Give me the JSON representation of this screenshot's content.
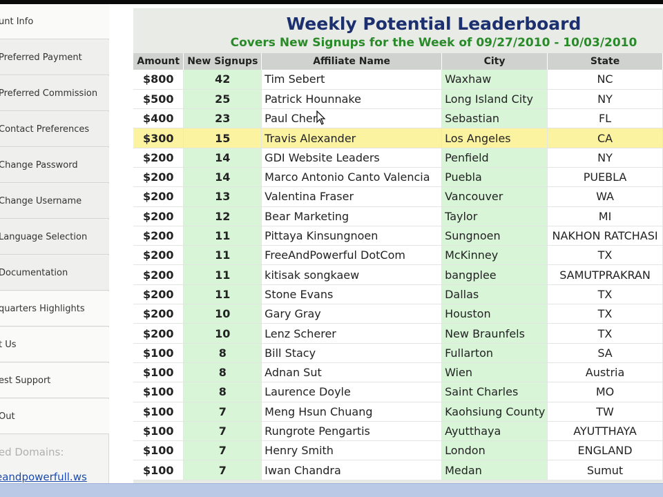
{
  "sidebar": {
    "items": [
      {
        "label": "unt Info"
      },
      {
        "label": "Preferred Payment"
      },
      {
        "label": "Preferred Commission"
      },
      {
        "label": "Contact Preferences"
      },
      {
        "label": "Change Password"
      },
      {
        "label": "Change Username"
      },
      {
        "label": "Language Selection"
      },
      {
        "label": "Documentation"
      },
      {
        "label": "quarters Highlights"
      },
      {
        "label": "t Us"
      },
      {
        "label": "est Support"
      },
      {
        "label": "Out"
      }
    ],
    "domains_label": "red Domains:",
    "domain_link": "eandpowerfull.ws"
  },
  "board": {
    "title": "Weekly Potential Leaderboard",
    "subtitle": "Covers New Signups for the Week of 09/27/2010 - 10/03/2010",
    "columns": [
      "Amount",
      "New Signups",
      "Affiliate Name",
      "City",
      "State"
    ],
    "rows": [
      {
        "amount": "$800",
        "signups": "42",
        "name": "Tim Sebert",
        "city": "Waxhaw",
        "state": "NC"
      },
      {
        "amount": "$500",
        "signups": "25",
        "name": "Patrick Hounnake",
        "city": "Long Island City",
        "state": "NY"
      },
      {
        "amount": "$400",
        "signups": "23",
        "name": "Paul Cher",
        "city": "Sebastian",
        "state": "FL"
      },
      {
        "amount": "$300",
        "signups": "15",
        "name": "Travis Alexander",
        "city": "Los Angeles",
        "state": "CA"
      },
      {
        "amount": "$200",
        "signups": "14",
        "name": "GDI Website Leaders",
        "city": "Penfield",
        "state": "NY"
      },
      {
        "amount": "$200",
        "signups": "14",
        "name": "Marco Antonio Canto Valencia",
        "city": "Puebla",
        "state": "PUEBLA"
      },
      {
        "amount": "$200",
        "signups": "13",
        "name": "Valentina Fraser",
        "city": "Vancouver",
        "state": "WA"
      },
      {
        "amount": "$200",
        "signups": "12",
        "name": "Bear Marketing",
        "city": "Taylor",
        "state": "MI"
      },
      {
        "amount": "$200",
        "signups": "11",
        "name": "Pittaya Kinsungnoen",
        "city": "Sungnoen",
        "state": "NAKHON RATCHASI"
      },
      {
        "amount": "$200",
        "signups": "11",
        "name": "FreeAndPowerful DotCom",
        "city": "McKinney",
        "state": "TX"
      },
      {
        "amount": "$200",
        "signups": "11",
        "name": "kitisak songkaew",
        "city": "bangplee",
        "state": "SAMUTPRAKRAN"
      },
      {
        "amount": "$200",
        "signups": "11",
        "name": "Stone Evans",
        "city": "Dallas",
        "state": "TX"
      },
      {
        "amount": "$200",
        "signups": "10",
        "name": "Gary Gray",
        "city": "Houston",
        "state": "TX"
      },
      {
        "amount": "$200",
        "signups": "10",
        "name": "Lenz Scherer",
        "city": "New Braunfels",
        "state": "TX"
      },
      {
        "amount": "$100",
        "signups": "8",
        "name": "Bill Stacy",
        "city": "Fullarton",
        "state": "SA"
      },
      {
        "amount": "$100",
        "signups": "8",
        "name": "Adnan Sut",
        "city": "Wien",
        "state": "Austria"
      },
      {
        "amount": "$100",
        "signups": "8",
        "name": "Laurence Doyle",
        "city": "Saint Charles",
        "state": "MO"
      },
      {
        "amount": "$100",
        "signups": "7",
        "name": "Meng Hsun Chuang",
        "city": "Kaohsiung County",
        "state": "TW"
      },
      {
        "amount": "$100",
        "signups": "7",
        "name": "Rungrote Pengartis",
        "city": "Ayutthaya",
        "state": "AYUTTHAYA"
      },
      {
        "amount": "$100",
        "signups": "7",
        "name": "Henry Smith",
        "city": "London",
        "state": "ENGLAND"
      },
      {
        "amount": "$100",
        "signups": "7",
        "name": "Iwan Chandra",
        "city": "Medan",
        "state": "Sumut"
      }
    ],
    "highlighted_row": 3
  },
  "colors": {
    "title": "#1c2f6e",
    "subtitle": "#2a8a2a",
    "green_column": "#d8f5d8",
    "highlight_row": "#fbf3a0",
    "link": "#1a4ab0"
  },
  "icons": {
    "cursor": "mouse-pointer-icon"
  }
}
